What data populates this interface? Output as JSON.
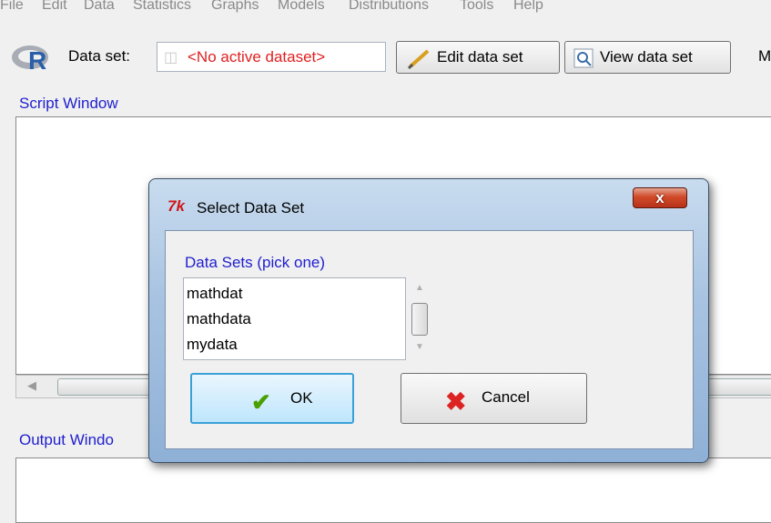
{
  "menu": [
    "File",
    "Edit",
    "Data",
    "Statistics",
    "Graphs",
    "Models",
    "Distributions",
    "Tools",
    "Help"
  ],
  "toolbar": {
    "dataset_label": "Data set:",
    "dataset_value": "<No active dataset>",
    "edit_label": "Edit data set",
    "view_label": "View data set",
    "cut_label": "M"
  },
  "script_window": {
    "label": "Script Window"
  },
  "output_window": {
    "label": "Output Windo"
  },
  "dialog": {
    "title": "Select Data Set",
    "close_label": "x",
    "list_title": "Data Sets (pick one)",
    "items": [
      "mathdat",
      "mathdata",
      "mydata"
    ],
    "ok_label": "OK",
    "cancel_label": "Cancel"
  },
  "colors": {
    "accent_blue": "#2020d0",
    "error_red": "#e02020",
    "close_red": "#c8452a"
  },
  "icons": [
    "r-logo-icon",
    "edit-pencil-icon",
    "view-magnifier-icon",
    "tk-icon",
    "check-icon",
    "cancel-x-icon"
  ]
}
